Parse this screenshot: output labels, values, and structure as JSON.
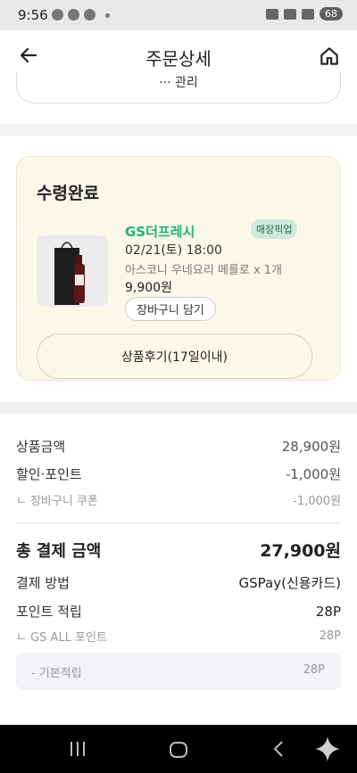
{
  "status_bar": {
    "time": "9:56",
    "battery": "68"
  },
  "header": {
    "title": "주문상세"
  },
  "top_card": {
    "label": "··· 관리"
  },
  "order": {
    "status": "수령완료",
    "store_name": "GS더프레시",
    "pickup_badge": "매장픽업",
    "date": "02/21(토) 18:00",
    "product_name": "아스코니 우네요리 메를로 x 1개",
    "price": "9,900원",
    "cart_button": "장바구니 담기",
    "review_button": "상품후기(17일이내)"
  },
  "payment": {
    "product_amount_label": "상품금액",
    "product_amount": "28,900원",
    "discount_label": "할인·포인트",
    "discount": "-1,000원",
    "coupon_label": "ㄴ 장바구니 쿠폰",
    "coupon": "-1,000원",
    "total_label": "총 결제 금액",
    "total": "27,900원",
    "method_label": "결제 방법",
    "method": "GSPay(신용카드)",
    "points_label": "포인트 적립",
    "points": "28P",
    "gs_all_label": "ㄴ GS ALL 포인트",
    "gs_all": "28P",
    "basic_label": "- 기본적립",
    "basic": "28P"
  },
  "colors": {
    "accent_green": "#1fb57a",
    "card_bg": "#fbf8e9",
    "badge_bg": "#cfe9dc"
  },
  "icons": {
    "back": "arrow-left-icon",
    "home": "home-icon"
  }
}
